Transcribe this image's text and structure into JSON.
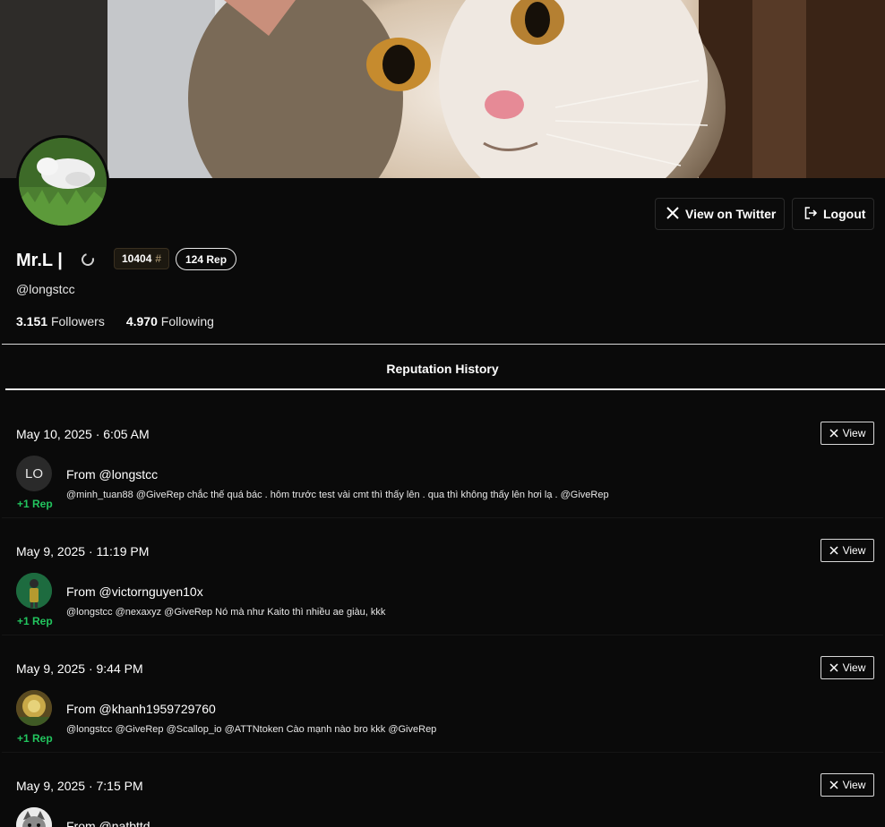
{
  "profile": {
    "name": "Mr.L |",
    "handle": "@longstcc",
    "rank": "10404",
    "rank_symbol": "#",
    "rep_badge": "124 Rep",
    "followers_count": "3.151",
    "followers_label": "Followers",
    "following_count": "4.970",
    "following_label": "Following"
  },
  "header": {
    "twitter_label": "View on Twitter",
    "logout_label": "Logout"
  },
  "section": {
    "title": "Reputation History"
  },
  "entries": [
    {
      "date": "May 10, 2025 · 6:05 AM",
      "view_label": "View",
      "avatar_initials": "LO",
      "from": "From @longstcc",
      "message": "@minh_tuan88 @GiveRep chắc thế quá bác . hôm trước test vài cmt thì thấy lên . qua thì không thấy lên hơi lạ . @GiveRep",
      "rep": "+1 Rep"
    },
    {
      "date": "May 9, 2025 · 11:19 PM",
      "view_label": "View",
      "avatar_initials": "",
      "from": "From @victornguyen10x",
      "message": "@longstcc @nexaxyz @GiveRep Nó mà như Kaito thì nhiều ae giàu, kkk",
      "rep": "+1 Rep"
    },
    {
      "date": "May 9, 2025 · 9:44 PM",
      "view_label": "View",
      "avatar_initials": "",
      "from": "From @khanh1959729760",
      "message": "@longstcc @GiveRep @Scallop_io @ATTNtoken Cào mạnh nào bro kkk @GiveRep",
      "rep": "+1 Rep"
    },
    {
      "date": "May 9, 2025 · 7:15 PM",
      "view_label": "View",
      "avatar_initials": "",
      "from": "From @natbttd",
      "message": "",
      "rep": ""
    }
  ],
  "colors": {
    "background": "#0a0a0a",
    "rep_green": "#22c55e",
    "accent_white": "#ffffff"
  },
  "icons": {
    "twitter": "x-logo-icon",
    "logout": "logout-icon",
    "spinner": "loading-spinner-icon"
  }
}
